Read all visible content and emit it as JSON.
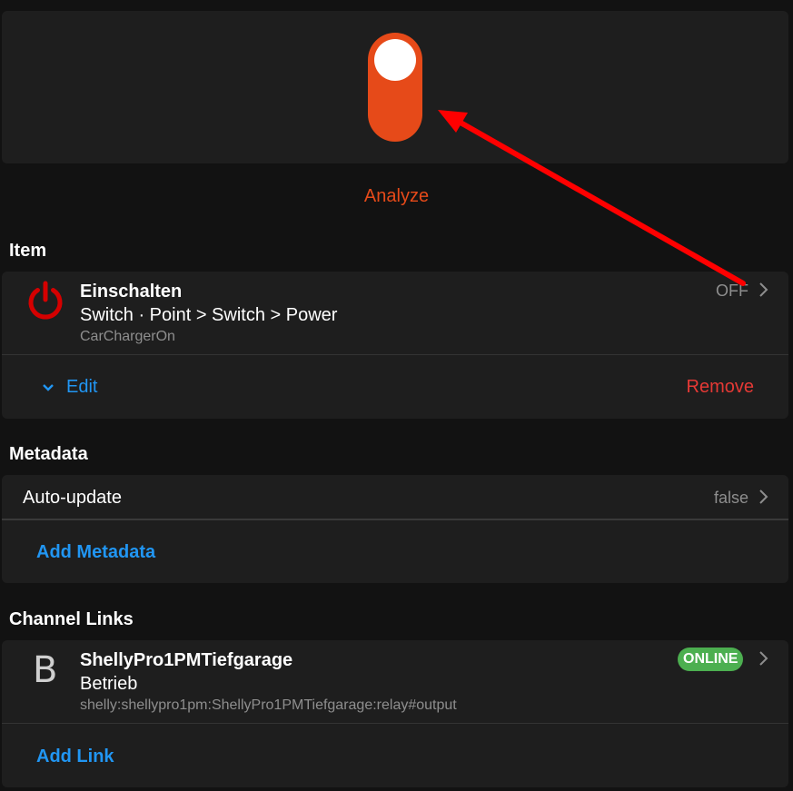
{
  "colors": {
    "accent": "#e64a19",
    "link": "#2196f3",
    "danger": "#e53935",
    "power_icon": "#d50000",
    "online": "#4caf50",
    "arrow": "#ff0000"
  },
  "toggle": {
    "state": "on",
    "icon": "toggle-switch"
  },
  "analyze_label": "Analyze",
  "item_section": {
    "title": "Item",
    "item": {
      "icon": "power-icon",
      "name": "Einschalten",
      "type": "Switch · Point > Switch > Power",
      "id": "CarChargerOn",
      "state": "OFF"
    },
    "edit_label": "Edit",
    "remove_label": "Remove"
  },
  "metadata_section": {
    "title": "Metadata",
    "rows": [
      {
        "label": "Auto-update",
        "value": "false"
      }
    ],
    "add_label": "Add Metadata"
  },
  "channel_section": {
    "title": "Channel Links",
    "link": {
      "avatar_letter": "B",
      "name": "ShellyPro1PMTiefgarage",
      "channel": "Betrieb",
      "uid": "shelly:shellypro1pm:ShellyPro1PMTiefgarage:relay#output",
      "status": "ONLINE"
    },
    "add_label": "Add Link"
  }
}
